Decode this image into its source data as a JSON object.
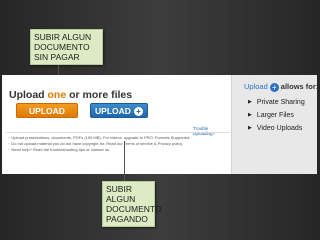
{
  "notes": {
    "top": "SUBIR ALGUN DOCUMENTO SIN PAGAR",
    "bottom": "SUBIR ALGUN DOCUMENTO PAGANDO"
  },
  "upload": {
    "title_prefix": "Upload ",
    "title_highlight": "one",
    "title_suffix": " or more files",
    "upload_button": "UPLOAD",
    "upload_plus_button": "UPLOAD",
    "plus_symbol": "+",
    "troubleshoot_link": "Trouble uploading?"
  },
  "info_lines": [
    "Upload presentations, documents, PDFs (100 MB). For videos, upgrade to PRO. Formats Supported...",
    "Do not upload material you do not have copyright for. Read our Terms of service & Privacy policy.",
    "Need help? Read the troubleshooting tips or contact us."
  ],
  "sidebar": {
    "title_link": "Upload",
    "title_symbol": "+",
    "title_suffix": "allows for:",
    "features": [
      "Private Sharing",
      "Larger Files",
      "Video Uploads"
    ]
  },
  "colors": {
    "orange_button": "#e8870f",
    "blue_button": "#2a71bf",
    "note_bg": "#dcebc4",
    "background": "#2e2e2e"
  },
  "icons": [
    "plus-icon",
    "triangle-right-icon"
  ]
}
